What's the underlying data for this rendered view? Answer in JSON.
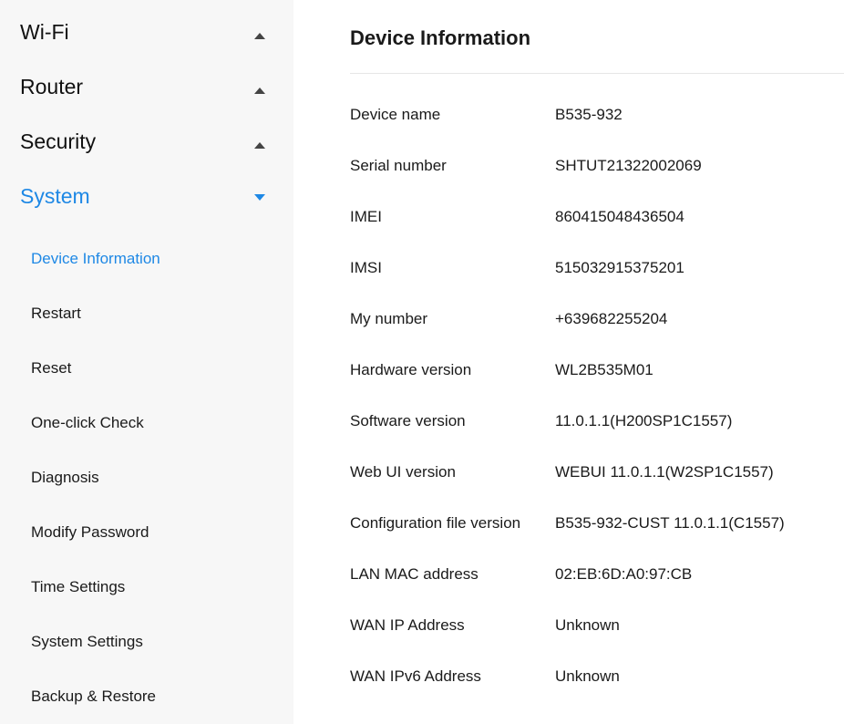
{
  "sidebar": {
    "sections": [
      {
        "label": "Wi-Fi"
      },
      {
        "label": "Router"
      },
      {
        "label": "Security"
      },
      {
        "label": "System"
      }
    ],
    "system_items": [
      {
        "label": "Device Information"
      },
      {
        "label": "Restart"
      },
      {
        "label": "Reset"
      },
      {
        "label": "One-click Check"
      },
      {
        "label": "Diagnosis"
      },
      {
        "label": "Modify Password"
      },
      {
        "label": "Time Settings"
      },
      {
        "label": "System Settings"
      },
      {
        "label": "Backup & Restore"
      }
    ]
  },
  "main": {
    "title": "Device Information",
    "rows": [
      {
        "label": "Device name",
        "value": "B535-932"
      },
      {
        "label": "Serial number",
        "value": "SHTUT21322002069"
      },
      {
        "label": "IMEI",
        "value": "860415048436504"
      },
      {
        "label": "IMSI",
        "value": "515032915375201"
      },
      {
        "label": "My number",
        "value": "+639682255204"
      },
      {
        "label": "Hardware version",
        "value": "WL2B535M01"
      },
      {
        "label": "Software version",
        "value": "11.0.1.1(H200SP1C1557)"
      },
      {
        "label": "Web UI version",
        "value": "WEBUI 11.0.1.1(W2SP1C1557)"
      },
      {
        "label": "Configuration file version",
        "value": "B535-932-CUST 11.0.1.1(C1557)"
      },
      {
        "label": "LAN MAC address",
        "value": "02:EB:6D:A0:97:CB"
      },
      {
        "label": "WAN IP Address",
        "value": "Unknown"
      },
      {
        "label": "WAN IPv6 Address",
        "value": "Unknown"
      }
    ]
  },
  "colors": {
    "accent": "#1e88e5",
    "sidebar_bg": "#f7f7f7",
    "text": "#1a1a1a"
  },
  "icons": {
    "collapsed": "caret-up-icon",
    "expanded": "caret-down-icon"
  }
}
